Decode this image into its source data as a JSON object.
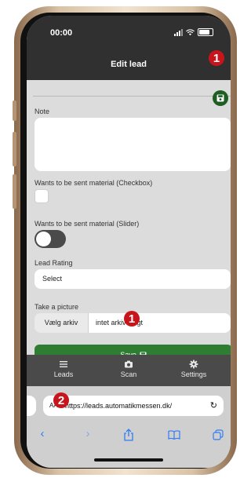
{
  "status_bar": {
    "time": "00:00"
  },
  "nav": {
    "title": "Edit lead"
  },
  "form": {
    "note_label": "Note",
    "checkbox_label": "Wants to be sent material (Checkbox)",
    "slider_label": "Wants to be sent material (Slider)",
    "lead_rating_label": "Lead Rating",
    "lead_rating_value": "Select",
    "picture_label": "Take a picture",
    "file_button_label": "Vælg arkiv",
    "file_status": "intet arkiv valgt",
    "save_button_label": "Save"
  },
  "tabs": [
    {
      "label": "Leads",
      "icon": "list-icon"
    },
    {
      "label": "Scan",
      "icon": "camera-icon"
    },
    {
      "label": "Settings",
      "icon": "gear-icon"
    }
  ],
  "browser": {
    "text_size_label": "AA",
    "url": "https://leads.automatikmessen.dk/"
  },
  "markers": [
    "1",
    "1",
    "2"
  ],
  "colors": {
    "header": "#303030",
    "save_green": "#2e7d32",
    "fab_green": "#1f5e23",
    "marker_red": "#c8151b",
    "ios_blue": "#2f7cf6"
  }
}
